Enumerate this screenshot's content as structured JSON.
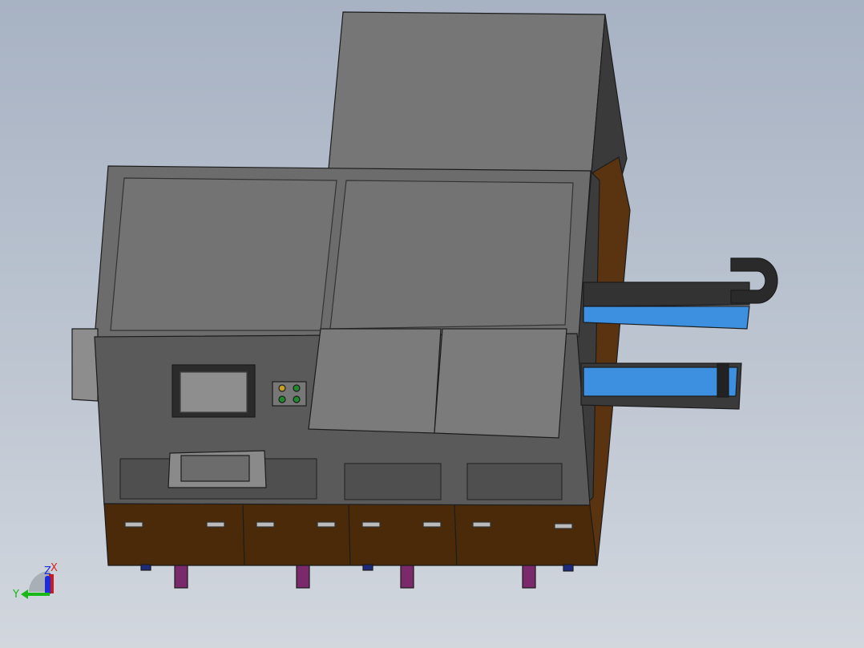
{
  "viewport": {
    "triad": {
      "x_label": "X",
      "y_label": "Y",
      "z_label": "Z",
      "x_color": "#e02020",
      "y_color": "#18b818",
      "z_color": "#1a2ee0"
    }
  },
  "colors": {
    "body_gray": "#6f6f6f",
    "base_brown": "#4a2a08",
    "rail_blue": "#3d8fe0",
    "leg_purple": "#7a2a6a"
  }
}
